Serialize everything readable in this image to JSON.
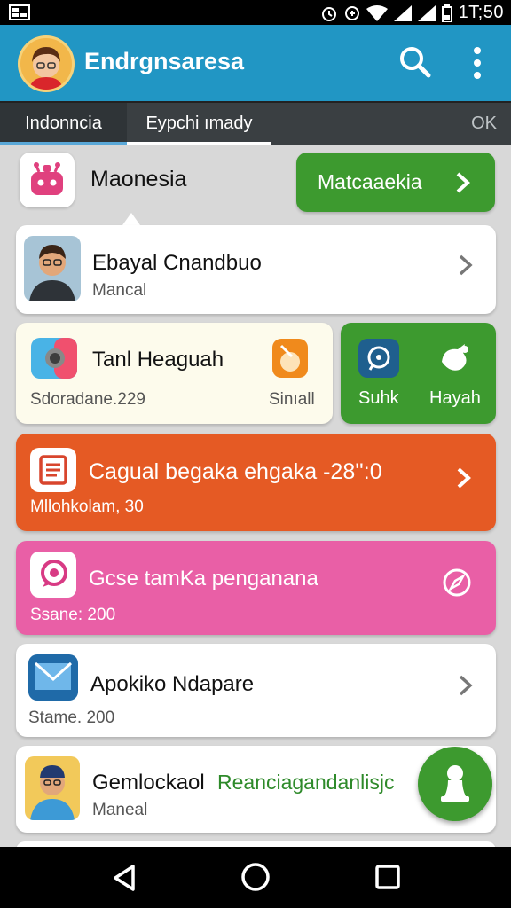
{
  "status_bar": {
    "time": "1T;50"
  },
  "app_bar": {
    "title": "Endrgnsaresa"
  },
  "tabs": [
    {
      "label": "Indonncia"
    },
    {
      "label": "Eypchi ımady"
    },
    {
      "label": "OK"
    }
  ],
  "header_section": {
    "label": "Maonesia",
    "action_label": "Matcaaekia"
  },
  "items": [
    {
      "title": "Ebayal Cnandbuo",
      "subtitle": "Mancal"
    },
    {
      "title": "Tanl Heaguah",
      "subtitle": "Sdoradane.229",
      "side_label": "Sinıall",
      "actions": [
        {
          "label": "Suhk"
        },
        {
          "label": "Hayah"
        }
      ]
    },
    {
      "title": "Cagual begaka ehgaka -28'':0",
      "subtitle": "Mllohkolam, 30"
    },
    {
      "title": "Gcse tamKa penganana",
      "subtitle": "Ssane: 200"
    },
    {
      "title": "Apokiko Ndapare",
      "subtitle": "Stame. 200"
    },
    {
      "title": "Gemlockaol",
      "highlight": "Reanciagandanlisjc",
      "subtitle": "Maneal"
    }
  ],
  "colors": {
    "app_bar": "#2196c4",
    "green": "#3d9a2f",
    "orange": "#e55a24",
    "pink": "#e95fa6",
    "tab_bar": "#3a3f42"
  },
  "icons": [
    "search-icon",
    "more-vert-icon",
    "chevron-right-icon",
    "back-icon",
    "home-icon",
    "recents-icon",
    "person-icon",
    "mail-icon"
  ]
}
